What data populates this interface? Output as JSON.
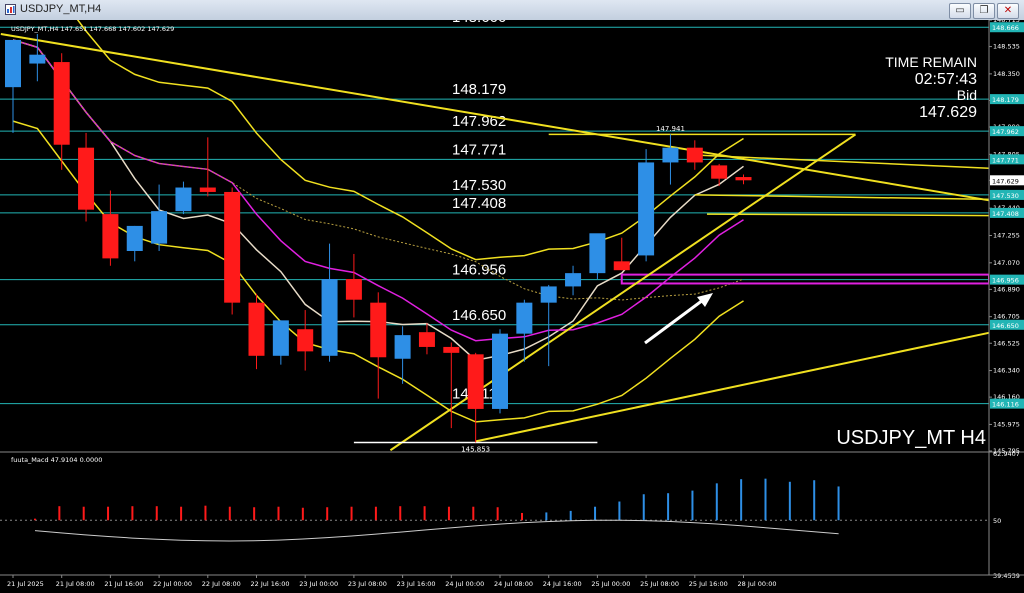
{
  "window": {
    "title": "USDJPY_MT,H4",
    "minimize_glyph": "▭",
    "restore_glyph": "❐",
    "close_glyph": "✕"
  },
  "header": {
    "symbol_line": "USDJPY_MT,H4  147.651 147.668 147.602 147.629"
  },
  "info_panel": {
    "time_remain_label": "TIME REMAIN",
    "time_remain": "02:57:43",
    "bid_label": "Bid",
    "bid": "147.629"
  },
  "watermark": "USDJPY_MT H4",
  "colors": {
    "bull": "#2e8fe6",
    "bear": "#ff1a1a",
    "level_line": "#22b5b5",
    "trend": "#f0e020",
    "magenta": "#e020e0",
    "ma_white": "#e8dcc8",
    "grid_text": "#ffffff"
  },
  "chart_data": [
    {
      "type": "candlestick",
      "ylim": [
        145.795,
        148.715
      ],
      "y_ticks": [
        "148.715",
        "148.535",
        "148.350",
        "148.170",
        "147.990",
        "147.805",
        "147.629",
        "147.440",
        "147.255",
        "147.070",
        "146.890",
        "146.705",
        "146.525",
        "146.340",
        "146.160",
        "145.975",
        "145.795"
      ],
      "x_ticks": [
        "21 Jul 2025",
        "21 Jul 08:00",
        "21 Jul 16:00",
        "22 Jul 00:00",
        "22 Jul 08:00",
        "22 Jul 16:00",
        "23 Jul 00:00",
        "23 Jul 08:00",
        "23 Jul 16:00",
        "24 Jul 00:00",
        "24 Jul 08:00",
        "24 Jul 16:00",
        "25 Jul 00:00",
        "25 Jul 08:00",
        "25 Jul 16:00",
        "28 Jul 00:00"
      ],
      "x_tick_index": [
        0,
        2,
        4,
        6,
        8,
        10,
        12,
        14,
        16,
        18,
        20,
        22,
        24,
        26,
        28,
        30
      ],
      "candles": [
        {
          "o": 148.26,
          "h": 148.4,
          "l": 147.95,
          "c": 148.58
        },
        {
          "o": 148.42,
          "h": 148.62,
          "l": 148.3,
          "c": 148.48
        },
        {
          "o": 148.43,
          "h": 148.49,
          "l": 147.7,
          "c": 147.87
        },
        {
          "o": 147.85,
          "h": 147.95,
          "l": 147.35,
          "c": 147.43
        },
        {
          "o": 147.4,
          "h": 147.56,
          "l": 147.05,
          "c": 147.1
        },
        {
          "o": 147.15,
          "h": 147.32,
          "l": 147.08,
          "c": 147.32
        },
        {
          "o": 147.2,
          "h": 147.6,
          "l": 147.15,
          "c": 147.42
        },
        {
          "o": 147.42,
          "h": 147.62,
          "l": 147.4,
          "c": 147.58
        },
        {
          "o": 147.58,
          "h": 147.92,
          "l": 147.52,
          "c": 147.55
        },
        {
          "o": 147.55,
          "h": 147.58,
          "l": 146.72,
          "c": 146.8
        },
        {
          "o": 146.8,
          "h": 146.86,
          "l": 146.35,
          "c": 146.44
        },
        {
          "o": 146.44,
          "h": 146.68,
          "l": 146.38,
          "c": 146.68
        },
        {
          "o": 146.62,
          "h": 146.75,
          "l": 146.34,
          "c": 146.47
        },
        {
          "o": 146.44,
          "h": 147.2,
          "l": 146.4,
          "c": 146.96
        },
        {
          "o": 146.96,
          "h": 147.13,
          "l": 146.7,
          "c": 146.82
        },
        {
          "o": 146.8,
          "h": 146.87,
          "l": 146.15,
          "c": 146.43
        },
        {
          "o": 146.42,
          "h": 146.64,
          "l": 146.25,
          "c": 146.58
        },
        {
          "o": 146.6,
          "h": 146.66,
          "l": 146.45,
          "c": 146.5
        },
        {
          "o": 146.5,
          "h": 146.53,
          "l": 145.95,
          "c": 146.46
        },
        {
          "o": 146.45,
          "h": 146.46,
          "l": 145.853,
          "c": 146.08
        },
        {
          "o": 146.08,
          "h": 146.62,
          "l": 146.05,
          "c": 146.59
        },
        {
          "o": 146.59,
          "h": 146.82,
          "l": 146.4,
          "c": 146.8
        },
        {
          "o": 146.8,
          "h": 146.92,
          "l": 146.37,
          "c": 146.91
        },
        {
          "o": 146.91,
          "h": 147.05,
          "l": 146.85,
          "c": 147.0
        },
        {
          "o": 147.0,
          "h": 147.26,
          "l": 146.96,
          "c": 147.27
        },
        {
          "o": 147.08,
          "h": 147.24,
          "l": 147.02,
          "c": 147.02
        },
        {
          "o": 147.12,
          "h": 147.84,
          "l": 147.08,
          "c": 147.75
        },
        {
          "o": 147.75,
          "h": 147.941,
          "l": 147.6,
          "c": 147.85
        },
        {
          "o": 147.85,
          "h": 147.9,
          "l": 147.7,
          "c": 147.75
        },
        {
          "o": 147.73,
          "h": 147.74,
          "l": 147.59,
          "c": 147.64
        },
        {
          "o": 147.651,
          "h": 147.668,
          "l": 147.602,
          "c": 147.629
        }
      ],
      "levels": [
        {
          "value": 148.666,
          "label": "148.666"
        },
        {
          "value": 148.179,
          "label": "148.179"
        },
        {
          "value": 147.962,
          "label": "147.962"
        },
        {
          "value": 147.771,
          "label": "147.771"
        },
        {
          "value": 147.53,
          "label": "147.530"
        },
        {
          "value": 147.408,
          "label": "147.408"
        },
        {
          "value": 146.956,
          "label": "146.956"
        },
        {
          "value": 146.65,
          "label": "146.650"
        },
        {
          "value": 146.116,
          "label": "146.116"
        }
      ],
      "extremes": {
        "high": "147.941",
        "low": "145.853"
      },
      "trendlines": [
        {
          "x1": -0.5,
          "y1": 148.62,
          "x2": 40.2,
          "y2": 147.49
        },
        {
          "x1": 15.5,
          "y1": 145.8,
          "x2": 34.6,
          "y2": 147.94
        },
        {
          "x1": 19,
          "y1": 145.86,
          "x2": 40.2,
          "y2": 146.6
        }
      ],
      "channel_lines": [
        {
          "x1": 22,
          "y1": 147.94,
          "x2": 34.6,
          "y2": 147.94
        },
        {
          "x1": 28,
          "y1": 147.8,
          "x2": 40.2,
          "y2": 147.71
        },
        {
          "x1": 28,
          "y1": 147.53,
          "x2": 40.2,
          "y2": 147.5
        },
        {
          "x1": 28.5,
          "y1": 147.4,
          "x2": 40.2,
          "y2": 147.39
        },
        {
          "x1": 14,
          "y1": 145.853,
          "x2": 24,
          "y2": 145.853
        }
      ],
      "magenta_zone": {
        "top": 146.99,
        "bottom": 146.93,
        "x_start": 25
      }
    },
    {
      "type": "histogram",
      "title": "fuuta_Macd 47.9104  0.0000",
      "ylim": [
        39.4539,
        62.9407
      ],
      "y_ticks": [
        "62.9407",
        "50",
        "39.4539"
      ],
      "bars": [
        50.3,
        52.7,
        52.6,
        52.6,
        52.7,
        52.7,
        52.6,
        52.8,
        52.6,
        52.5,
        52.6,
        52.4,
        52.5,
        52.6,
        52.6,
        52.7,
        52.7,
        52.6,
        52.6,
        52.5,
        51.4,
        51.5,
        51.8,
        52.6,
        53.6,
        55.0,
        55.2,
        55.7,
        57.1,
        57.9,
        58.0,
        57.4,
        57.7,
        56.5
      ]
    }
  ]
}
